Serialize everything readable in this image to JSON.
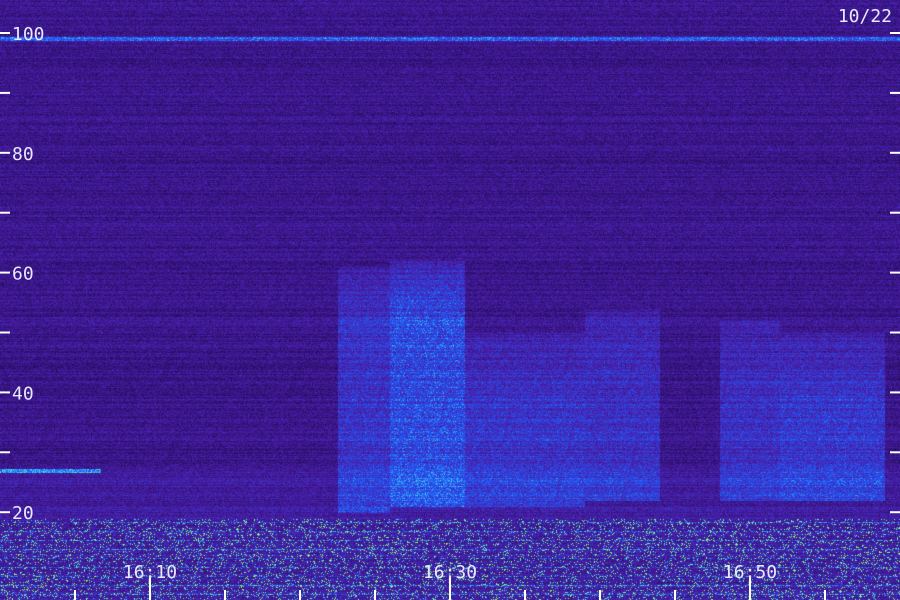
{
  "chart_data": {
    "type": "heatmap",
    "title": "",
    "date_label": "10/22",
    "xlabel": "",
    "ylabel": "",
    "ylim": [
      15,
      105
    ],
    "y_ticks": [
      {
        "value": 100,
        "label": "100"
      },
      {
        "value": 90,
        "label": ""
      },
      {
        "value": 80,
        "label": "80"
      },
      {
        "value": 70,
        "label": ""
      },
      {
        "value": 60,
        "label": "60"
      },
      {
        "value": 50,
        "label": ""
      },
      {
        "value": 40,
        "label": "40"
      },
      {
        "value": 30,
        "label": ""
      },
      {
        "value": 20,
        "label": "20"
      }
    ],
    "x_range_minutes": [
      16.0,
      16.998
    ],
    "x_major_ticks": [
      {
        "time": "16:10",
        "label": "16:10"
      },
      {
        "time": "16:30",
        "label": "16:30"
      },
      {
        "time": "16:50",
        "label": "16:50"
      }
    ],
    "x_minor_tick_times": [
      "16:05",
      "16:15",
      "16:20",
      "16:25",
      "16:35",
      "16:40",
      "16:45",
      "16:55"
    ],
    "colors": {
      "background": "#1a0a4a",
      "low": "#3a20a0",
      "mid": "#2050e0",
      "high": "#40d0ff",
      "peak": "#80ff80"
    },
    "features": [
      {
        "kind": "line",
        "y": 99,
        "intensity": 0.7
      },
      {
        "kind": "line",
        "y": 27,
        "time_start": "16:00",
        "time_end": "16:08",
        "intensity": 0.8
      },
      {
        "kind": "band",
        "y_min": 16,
        "y_max": 19,
        "intensity": 0.9
      }
    ],
    "activity_blocks": [
      {
        "time_start": "16:22.5",
        "time_end": "16:26",
        "y_min": 20,
        "y_max": 61,
        "intensity": 0.55
      },
      {
        "time_start": "16:26",
        "time_end": "16:31",
        "y_min": 21,
        "y_max": 62,
        "intensity": 0.8
      },
      {
        "time_start": "16:31",
        "time_end": "16:39",
        "y_min": 21,
        "y_max": 50,
        "intensity": 0.55
      },
      {
        "time_start": "16:39",
        "time_end": "16:44",
        "y_min": 22,
        "y_max": 54,
        "intensity": 0.5
      },
      {
        "time_start": "16:48",
        "time_end": "16:52",
        "y_min": 22,
        "y_max": 52,
        "intensity": 0.5
      },
      {
        "time_start": "16:52",
        "time_end": "16:59",
        "y_min": 22,
        "y_max": 50,
        "intensity": 0.6
      }
    ]
  }
}
